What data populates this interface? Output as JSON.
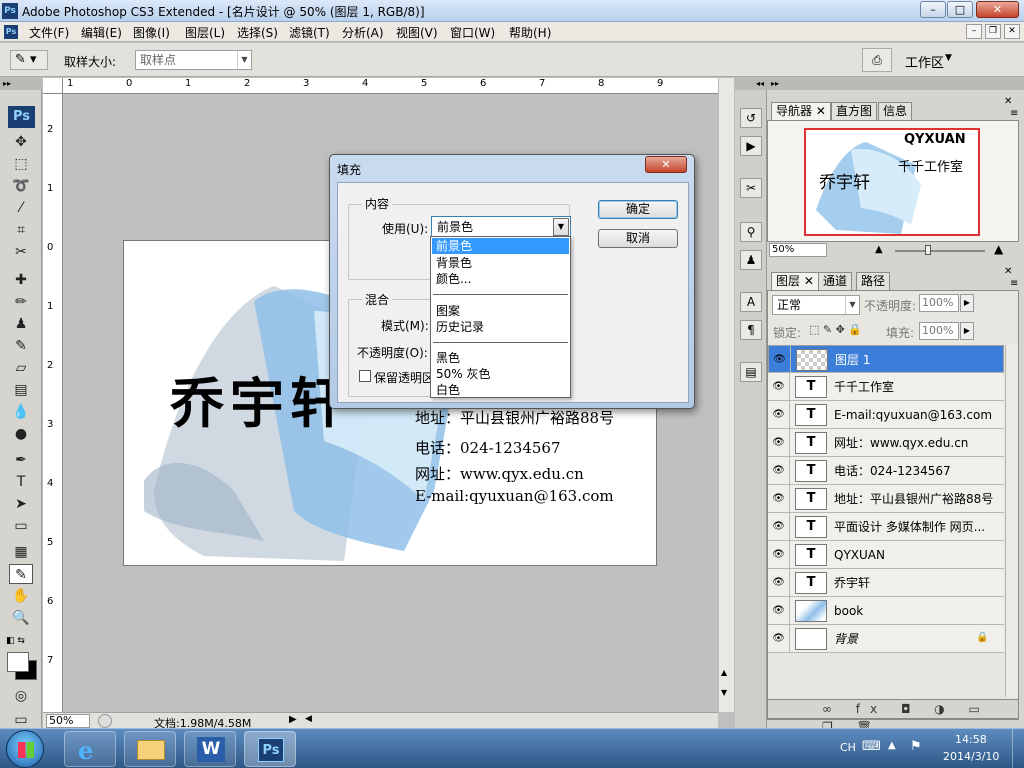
{
  "window": {
    "app_logo": "Ps",
    "title": "Adobe Photoshop CS3 Extended - [名片设计 @ 50% (图层 1, RGB/8)]",
    "controls": {
      "minimize": "–",
      "maximize": "□",
      "close": "✕"
    }
  },
  "menu": {
    "items": [
      "文件(F)",
      "编辑(E)",
      "图像(I)",
      "图层(L)",
      "选择(S)",
      "滤镜(T)",
      "分析(A)",
      "视图(V)",
      "窗口(W)",
      "帮助(H)"
    ],
    "doc_controls": {
      "minimize": "–",
      "restore": "❐",
      "close": "✕"
    }
  },
  "options_bar": {
    "sample_size_label": "取样大小:",
    "sample_size_value": "取样点",
    "workspace_label": "工作区"
  },
  "ruler": {
    "top_marks": [
      "1",
      "0",
      "1",
      "2",
      "3",
      "4",
      "5",
      "6",
      "7",
      "8",
      "9"
    ],
    "left_marks": [
      "2",
      "1",
      "0",
      "1",
      "2",
      "3",
      "4",
      "5",
      "6",
      "7"
    ]
  },
  "canvas": {
    "name_text": "乔宇轩",
    "address": "地址：平山县银州广裕路88号",
    "phone": "电话：024-1234567",
    "website": "网址：www.qyx.edu.cn",
    "email": "E-mail:qyuxuan@163.com"
  },
  "status_bar": {
    "zoom": "50%",
    "doc_size": "文档:1.98M/4.58M"
  },
  "dialog": {
    "title": "填充",
    "content_group": "内容",
    "use_label": "使用(U):",
    "use_value": "前景色",
    "blend_group": "混合",
    "mode_label": "模式(M):",
    "opacity_label": "不透明度(O):",
    "preserve_label": "保留透明区",
    "ok_label": "确定",
    "cancel_label": "取消",
    "dropdown_options": [
      {
        "label": "前景色",
        "selected": true
      },
      {
        "label": "背景色",
        "selected": false
      },
      {
        "label": "颜色...",
        "selected": false
      },
      {
        "label": "图案",
        "selected": false
      },
      {
        "label": "历史记录",
        "selected": false
      },
      {
        "label": "黑色",
        "selected": false
      },
      {
        "label": "50% 灰色",
        "selected": false
      },
      {
        "label": "白色",
        "selected": false
      }
    ]
  },
  "navigator_panel": {
    "tabs": [
      "导航器",
      "直方图",
      "信息"
    ],
    "zoom": "50%",
    "preview_title": "QYXUAN",
    "preview_studio": "千千工作室",
    "preview_name": "乔宇轩"
  },
  "layers_panel": {
    "tabs": [
      "图层",
      "通道",
      "路径"
    ],
    "blend_mode": "正常",
    "opacity_label": "不透明度:",
    "opacity_value": "100%",
    "lock_label": "锁定:",
    "fill_label": "填充:",
    "fill_value": "100%",
    "layers": [
      {
        "name": "图层 1",
        "type": "raster",
        "selected": true
      },
      {
        "name": "千千工作室",
        "type": "text",
        "selected": false
      },
      {
        "name": "E-mail:qyuxuan@163.com",
        "type": "text",
        "selected": false
      },
      {
        "name": "网址：www.qyx.edu.cn",
        "type": "text",
        "selected": false
      },
      {
        "name": "电话：024-1234567",
        "type": "text",
        "selected": false
      },
      {
        "name": "地址：平山县银州广裕路88号",
        "type": "text",
        "selected": false
      },
      {
        "name": "平面设计 多媒体制作 网页...",
        "type": "text",
        "selected": false
      },
      {
        "name": "QYXUAN",
        "type": "text",
        "selected": false
      },
      {
        "name": "乔宇轩",
        "type": "text",
        "selected": false
      },
      {
        "name": "book",
        "type": "smart",
        "selected": false
      },
      {
        "name": "背景",
        "type": "background",
        "selected": false
      }
    ],
    "text_thumb": "T"
  },
  "taskbar": {
    "lang": "CH",
    "time": "14:58",
    "date": "2014/3/10",
    "ps_label": "Ps"
  },
  "colors": {
    "selection_blue": "#3b7ed9",
    "dropdown_highlight": "#3399ff",
    "book_blue": "#8fc0e8"
  }
}
